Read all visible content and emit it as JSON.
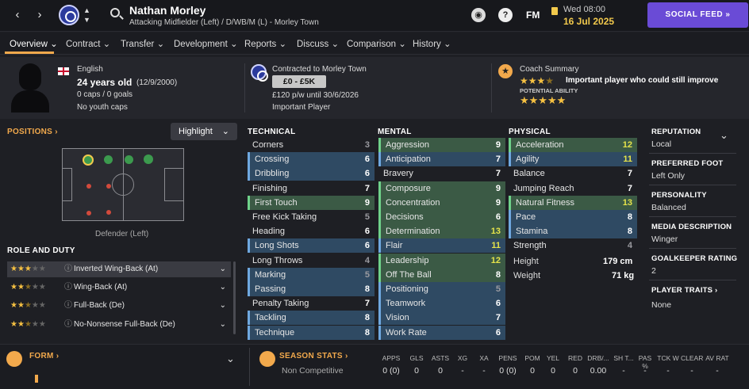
{
  "header": {
    "player_name": "Nathan Morley",
    "player_subtitle": "Attacking Midfielder (Left) / D/WB/M (L) - Morley Town",
    "fm_label": "FM",
    "time": "Wed 08:00",
    "date": "16 Jul 2025",
    "social_feed": "SOCIAL FEED",
    "notification_count": "2",
    "help_label": "?"
  },
  "tabs": [
    "Overview",
    "Contract",
    "Transfer",
    "Development",
    "Reports",
    "Discuss",
    "Comparison",
    "History"
  ],
  "profile": {
    "nationality": "English",
    "age": "24 years old",
    "dob": "(12/9/2000)",
    "caps": "0 caps / 0 goals",
    "youth_caps": "No youth caps",
    "contract_title": "Contracted to Morley Town",
    "wage_range": "£0 - £5K",
    "wage_detail": "£120 p/w until 30/6/2026",
    "status": "Important Player",
    "coach_title": "Coach Summary",
    "coach_text": "Important player who could still improve",
    "potential_label": "POTENTIAL ABILITY",
    "current_stars": 3.5,
    "potential_stars": 5
  },
  "positions": {
    "title": "POSITIONS",
    "highlight": "Highlight",
    "caption": "Defender (Left)"
  },
  "roles": {
    "title": "ROLE AND DUTY",
    "items": [
      {
        "name": "Inverted Wing-Back (At)",
        "stars": 3
      },
      {
        "name": "Wing-Back (At)",
        "stars": 2.5
      },
      {
        "name": "Full-Back (De)",
        "stars": 2.5
      },
      {
        "name": "No-Nonsense Full-Back (De)",
        "stars": 2.5
      }
    ]
  },
  "technical": {
    "title": "TECHNICAL",
    "items": [
      {
        "name": "Corners",
        "value": "3"
      },
      {
        "name": "Crossing",
        "value": "6"
      },
      {
        "name": "Dribbling",
        "value": "6"
      },
      {
        "name": "Finishing",
        "value": "7"
      },
      {
        "name": "First Touch",
        "value": "9"
      },
      {
        "name": "Free Kick Taking",
        "value": "5"
      },
      {
        "name": "Heading",
        "value": "6"
      },
      {
        "name": "Long Shots",
        "value": "6"
      },
      {
        "name": "Long Throws",
        "value": "4"
      },
      {
        "name": "Marking",
        "value": "5"
      },
      {
        "name": "Passing",
        "value": "8"
      },
      {
        "name": "Penalty Taking",
        "value": "7"
      },
      {
        "name": "Tackling",
        "value": "8"
      },
      {
        "name": "Technique",
        "value": "8"
      }
    ]
  },
  "mental": {
    "title": "MENTAL",
    "items": [
      {
        "name": "Aggression",
        "value": "9"
      },
      {
        "name": "Anticipation",
        "value": "7"
      },
      {
        "name": "Bravery",
        "value": "7"
      },
      {
        "name": "Composure",
        "value": "9"
      },
      {
        "name": "Concentration",
        "value": "9"
      },
      {
        "name": "Decisions",
        "value": "6"
      },
      {
        "name": "Determination",
        "value": "13"
      },
      {
        "name": "Flair",
        "value": "11"
      },
      {
        "name": "Leadership",
        "value": "12"
      },
      {
        "name": "Off The Ball",
        "value": "8"
      },
      {
        "name": "Positioning",
        "value": "5"
      },
      {
        "name": "Teamwork",
        "value": "6"
      },
      {
        "name": "Vision",
        "value": "7"
      },
      {
        "name": "Work Rate",
        "value": "6"
      }
    ]
  },
  "physical": {
    "title": "PHYSICAL",
    "items": [
      {
        "name": "Acceleration",
        "value": "12"
      },
      {
        "name": "Agility",
        "value": "11"
      },
      {
        "name": "Balance",
        "value": "7"
      },
      {
        "name": "Jumping Reach",
        "value": "7"
      },
      {
        "name": "Natural Fitness",
        "value": "13"
      },
      {
        "name": "Pace",
        "value": "8"
      },
      {
        "name": "Stamina",
        "value": "8"
      },
      {
        "name": "Strength",
        "value": "4"
      }
    ],
    "height_label": "Height",
    "height": "179 cm",
    "weight_label": "Weight",
    "weight": "71 kg"
  },
  "side": {
    "reputation_label": "REPUTATION",
    "reputation": "Local",
    "foot_label": "PREFERRED FOOT",
    "foot": "Left Only",
    "personality_label": "PERSONALITY",
    "personality": "Balanced",
    "media_label": "MEDIA DESCRIPTION",
    "media": "Winger",
    "gk_label": "GOALKEEPER RATING",
    "gk": "2",
    "traits_label": "PLAYER TRAITS",
    "traits": "None"
  },
  "bottom": {
    "form_label": "FORM",
    "season_label": "SEASON STATS",
    "competition": "Non Competitive",
    "columns": [
      "APPS",
      "GLS",
      "ASTS",
      "XG",
      "XA",
      "PENS",
      "POM",
      "YEL",
      "RED",
      "DRB/...",
      "SH T...",
      "PAS %",
      "TCK W",
      "CLEAR",
      "AV RAT"
    ],
    "values": [
      "0 (0)",
      "0",
      "0",
      "-",
      "-",
      "0 (0)",
      "0",
      "0",
      "0",
      "0.00",
      "-",
      "-",
      "-",
      "-",
      "-"
    ]
  },
  "colors": {
    "accent": "#f2a94c",
    "social": "#6a4bd6",
    "highlight_green": "#3b5a45",
    "highlight_blue": "#2f4a63",
    "star": "#f5c042"
  }
}
